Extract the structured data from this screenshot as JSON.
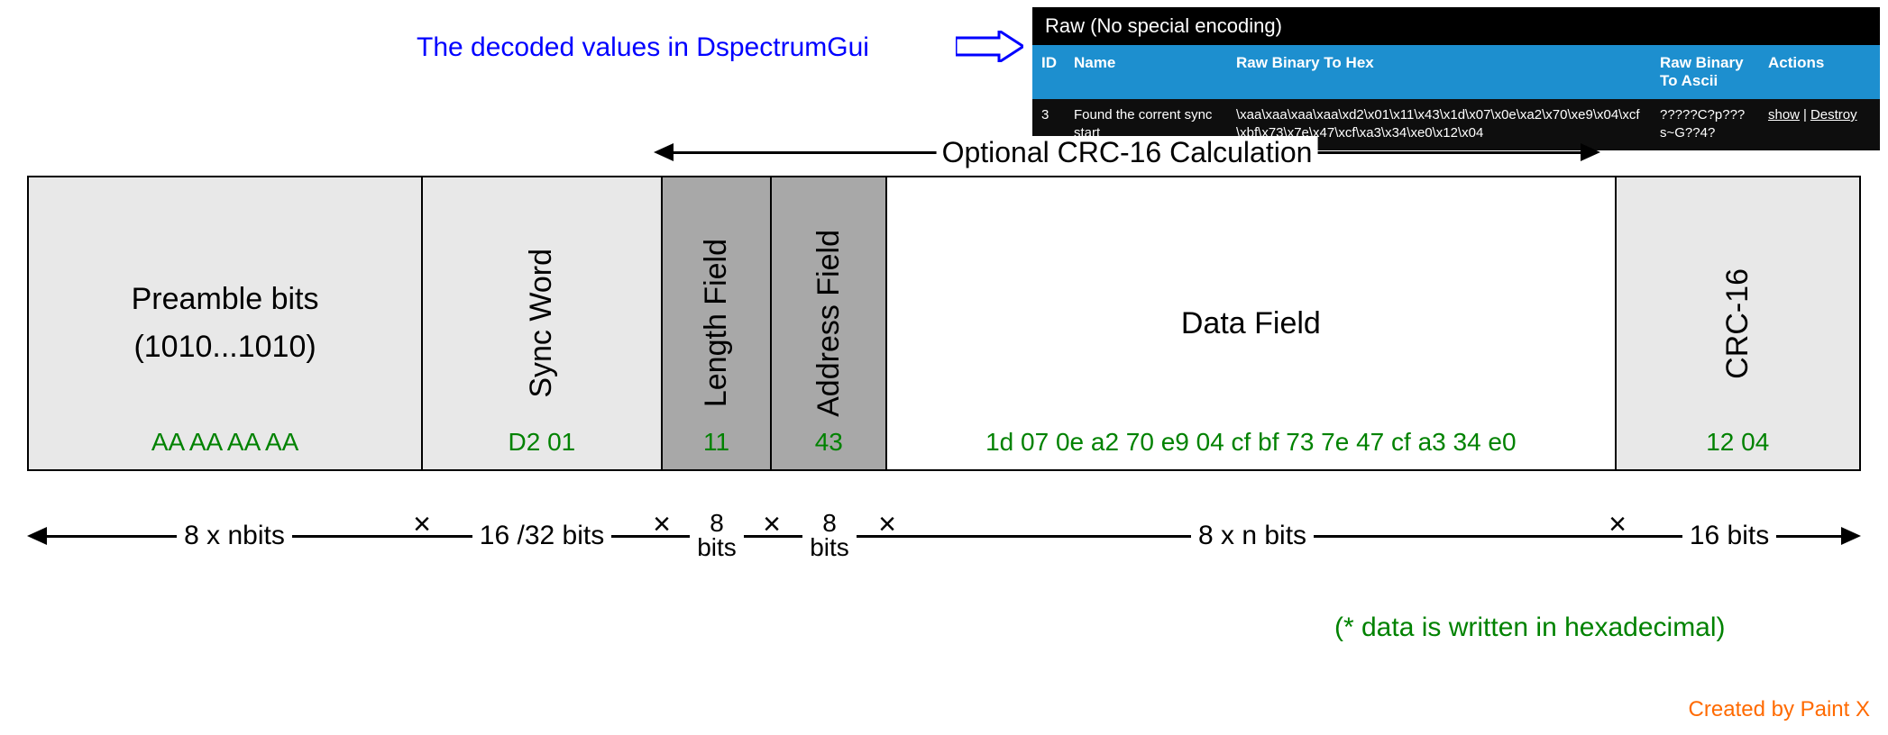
{
  "gui": {
    "title": "Raw (No special encoding)",
    "headers": {
      "id": "ID",
      "name": "Name",
      "hex": "Raw Binary To Hex",
      "ascii": "Raw Binary To Ascii",
      "actions": "Actions"
    },
    "row": {
      "id": "3",
      "name": "Found the corrent sync start",
      "hex": "\\xaa\\xaa\\xaa\\xaa\\xd2\\x01\\x11\\x43\\x1d\\x07\\x0e\\xa2\\x70\\xe9\\x04\\xcf\\xbf\\x73\\x7e\\x47\\xcf\\xa3\\x34\\xe0\\x12\\x04",
      "ascii": "?????C?p???s~G??4?",
      "action_show": "show",
      "action_destroy": "Destroy"
    }
  },
  "caption": "The decoded values in DspectrumGui",
  "crc_label": "Optional CRC-16 Calculation",
  "packet": {
    "preamble": {
      "title": "Preamble bits",
      "sub": "(1010...1010)",
      "hex": "AA AA AA AA"
    },
    "sync": {
      "title": "Sync Word",
      "hex": "D2 01"
    },
    "len": {
      "title": "Length Field",
      "hex": "11"
    },
    "addr": {
      "title": "Address Field",
      "hex": "43"
    },
    "data": {
      "title": "Data Field",
      "hex": "1d 07 0e a2 70 e9 04 cf bf 73 7e 47 cf a3 34 e0"
    },
    "crc": {
      "title": "CRC-16",
      "hex": "12 04"
    }
  },
  "dims": {
    "preamble": "8  x nbits",
    "sync": "16 /32  bits",
    "len_top": "8",
    "len_bot": "bits",
    "addr_top": "8",
    "addr_bot": "bits",
    "data": "8  x n bits",
    "crc": "16  bits"
  },
  "footnote": "(* data is written in hexadecimal)",
  "credit": "Created by Paint X"
}
